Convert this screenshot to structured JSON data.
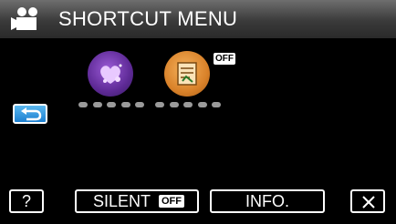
{
  "header": {
    "title": "SHORTCUT MENU"
  },
  "menu": {
    "items": [
      {
        "icon": "heart-sparkle-icon",
        "label_masked": true
      },
      {
        "icon": "notes-icon",
        "label_masked": true,
        "badge": "OFF"
      }
    ]
  },
  "footer": {
    "help_label": "?",
    "silent_label": "SILENT",
    "silent_state": "OFF",
    "info_label": "INFO.",
    "close_icon": "close-icon"
  },
  "colors": {
    "accent_blue": "#1c7fd0",
    "item1_purple": "#5e2a96",
    "item2_orange": "#d9822a"
  }
}
